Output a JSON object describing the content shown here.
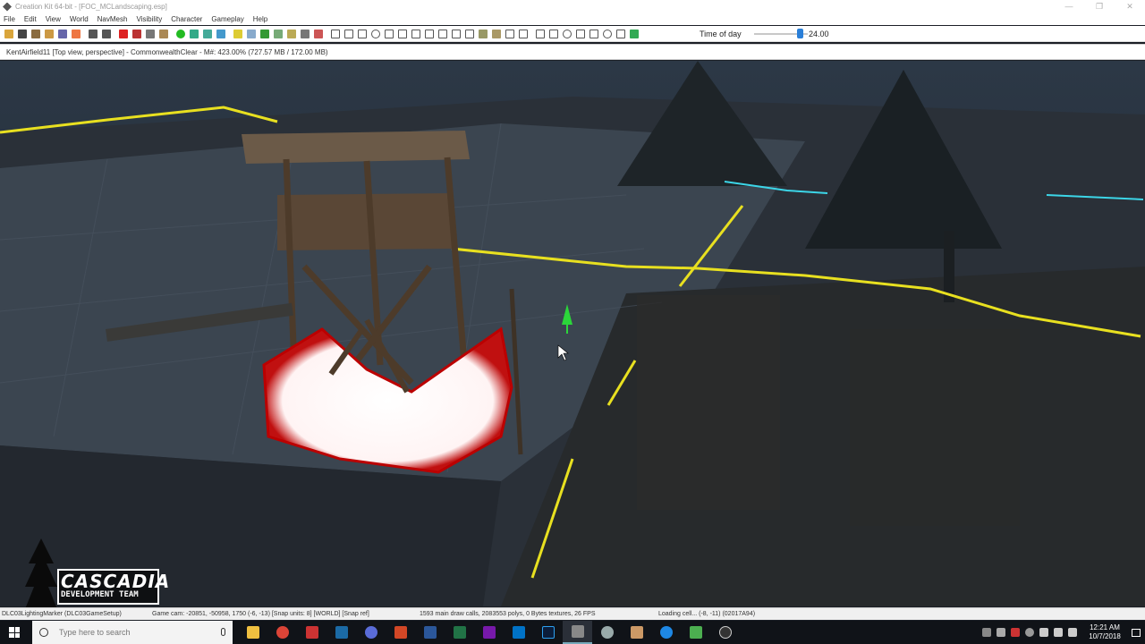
{
  "window": {
    "title": "Creation Kit 64-bit - [FOC_MCLandscaping.esp]",
    "controls": [
      "—",
      "❐",
      "✕"
    ]
  },
  "menu": [
    "File",
    "Edit",
    "View",
    "World",
    "NavMesh",
    "Visibility",
    "Character",
    "Gameplay",
    "Help"
  ],
  "toolbar": {
    "icons": [
      "open-icon",
      "save-icon",
      "settings-icon",
      "render-icon",
      "data-icon",
      "preferences-icon",
      "undo-icon",
      "redo-icon",
      "delete-icon",
      "paint-icon",
      "grid-icon",
      "snap-icon",
      "sphere-icon",
      "landscape-icon",
      "cell-icon",
      "navmesh-icon",
      "light-icon",
      "visibility-icon",
      "tree-icon",
      "water-icon",
      "marker-icon",
      "sound-icon",
      "path-icon"
    ],
    "time_of_day_label": "Time of day",
    "time_of_day_value": "24.00",
    "time_of_day_level": 0.85
  },
  "viewport": {
    "header": "KentAirfield11 [Top view, perspective] - CommonwealthClear - M#: 423.00% (727.57 MB / 172.00 MB)"
  },
  "status": {
    "left": "DLC03LightingMarker (DLC03GameSetup)",
    "camera": "Game cam: -20851, -50958, 1750 (-6, -13) [Snap units: 8] [WORLD] [Snap ref]",
    "render_stats": "1593 main draw calls, 2083553 polys, 0 Bytes textures, 26 FPS",
    "loading": "Loading cell... (-8, -11) (02017A94)"
  },
  "taskbar": {
    "search_placeholder": "Type here to search",
    "apps": [
      "file-explorer",
      "chrome",
      "mail",
      "steam",
      "browser",
      "powerpoint",
      "word",
      "excel",
      "onenote",
      "outlook",
      "photoshop",
      "creation-kit",
      "fallout",
      "game",
      "maps",
      "notepad",
      "obs"
    ],
    "time": "12:21 AM",
    "date": "10/7/2018"
  },
  "watermark": {
    "title": "CASCADIA",
    "subtitle": "DEVELOPMENT TEAM"
  }
}
